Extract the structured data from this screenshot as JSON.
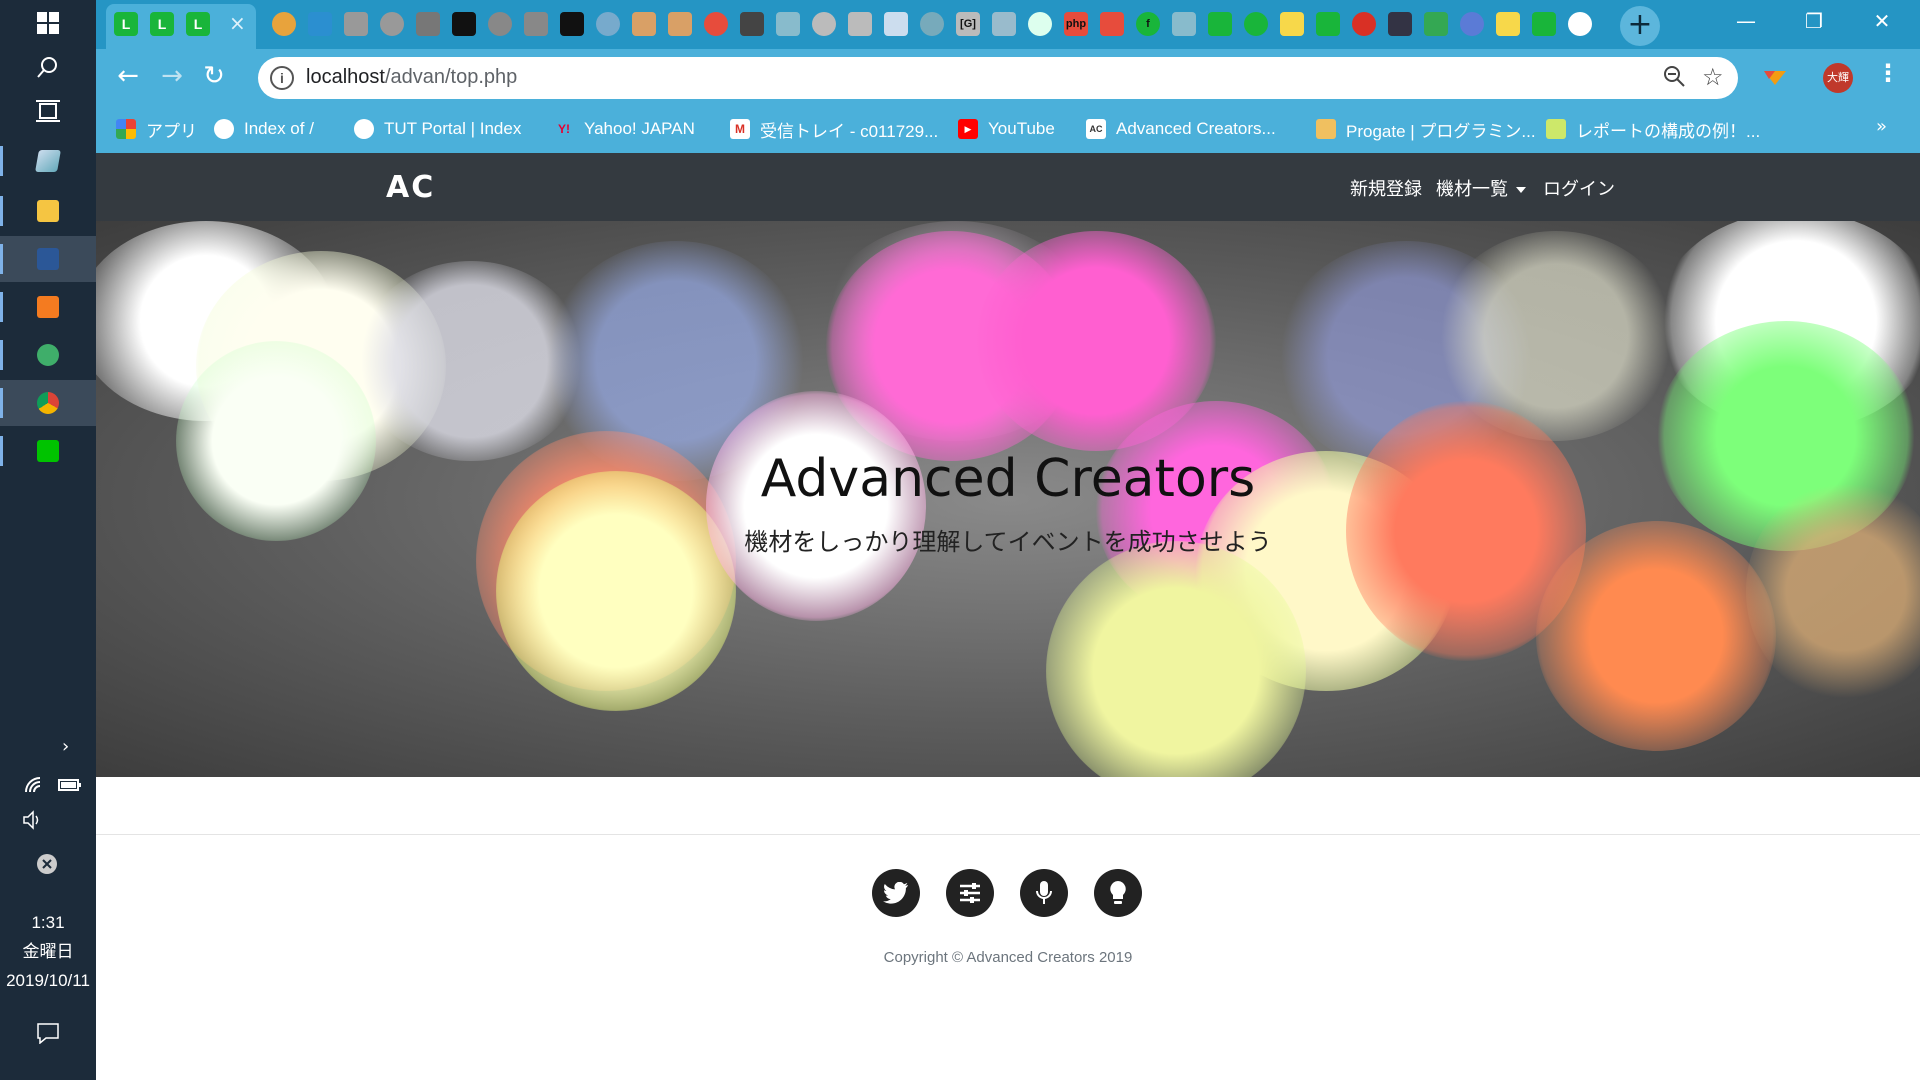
{
  "taskbar": {
    "clock_time": "1:31",
    "clock_day": "金曜日",
    "clock_date": "2019/10/11"
  },
  "browser": {
    "url_host": "localhost",
    "url_path": "/advan/top.php",
    "profile_initials": "大輝",
    "new_tab_label": "+",
    "favicon_labels": [
      "L",
      "L",
      "L",
      "[G]",
      "php",
      "f"
    ],
    "bookmarks": [
      {
        "label": "アプリ",
        "icon": "apps-grid-icon"
      },
      {
        "label": "Index of /",
        "icon": "globe-icon"
      },
      {
        "label": "TUT Portal | Index",
        "icon": "globe-icon"
      },
      {
        "label": "Yahoo! JAPAN",
        "icon": "yahoo-icon"
      },
      {
        "label": "受信トレイ - c011729...",
        "icon": "gmail-icon"
      },
      {
        "label": "YouTube",
        "icon": "youtube-icon"
      },
      {
        "label": "Advanced Creators...",
        "icon": "ac-icon"
      },
      {
        "label": "Progate | プログラミン...",
        "icon": "progate-icon"
      },
      {
        "label": "レポートの構成の例！...",
        "icon": "report-icon"
      }
    ]
  },
  "site": {
    "brand": "AC",
    "nav": {
      "register": "新規登録",
      "equipment": "機材一覧",
      "login": "ログイン"
    },
    "hero": {
      "title": "Advanced Creators",
      "subtitle": "機材をしっかり理解してイベントを成功させよう"
    },
    "footer": {
      "social_icons": [
        "twitter-icon",
        "sliders-icon",
        "microphone-icon",
        "lightbulb-icon"
      ],
      "copyright": "Copyright © Advanced Creators 2019"
    }
  },
  "colors": {
    "tabstrip": "#2595c4",
    "toolbar": "#4bb0da",
    "site_nav": "#343a40",
    "taskbar": "#1c2b3a"
  }
}
